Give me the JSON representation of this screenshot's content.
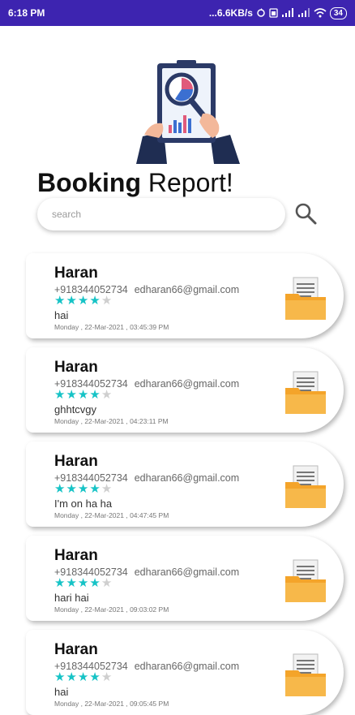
{
  "status_bar": {
    "time": "6:18 PM",
    "network_speed": "...6.6KB/s",
    "battery": "34",
    "icons": [
      "sync-icon",
      "sim-icon",
      "signal-icon",
      "signal-icon",
      "wifi-icon"
    ]
  },
  "header": {
    "title_bold": "Booking",
    "title_rest": " Report!",
    "illustration": "clipboard-magnifier-illustration"
  },
  "search": {
    "placeholder": "search",
    "value": "",
    "icon": "search-icon"
  },
  "colors": {
    "status_bar": "#3d24b0",
    "star_filled": "#16c3c6",
    "star_empty": "#cfcfcf",
    "folder": "#f4a42a"
  },
  "bookings": [
    {
      "name": "Haran",
      "phone": "+918344052734",
      "email": "edharan66@gmail.com",
      "rating": 4,
      "max_rating": 5,
      "message": "hai",
      "date": "Monday , 22-Mar-2021 , 03:45:39 PM"
    },
    {
      "name": "Haran",
      "phone": "+918344052734",
      "email": "edharan66@gmail.com",
      "rating": 4,
      "max_rating": 5,
      "message": "ghhtcvgy",
      "date": "Monday , 22-Mar-2021 , 04:23:11 PM"
    },
    {
      "name": "Haran",
      "phone": "+918344052734",
      "email": "edharan66@gmail.com",
      "rating": 4,
      "max_rating": 5,
      "message": "I'm on ha ha",
      "date": "Monday , 22-Mar-2021 , 04:47:45 PM"
    },
    {
      "name": "Haran",
      "phone": "+918344052734",
      "email": "edharan66@gmail.com",
      "rating": 4,
      "max_rating": 5,
      "message": "hari hai",
      "date": "Monday , 22-Mar-2021 , 09:03:02 PM"
    },
    {
      "name": "Haran",
      "phone": "+918344052734",
      "email": "edharan66@gmail.com",
      "rating": 4,
      "max_rating": 5,
      "message": "hai",
      "date": "Monday , 22-Mar-2021 , 09:05:45 PM"
    }
  ]
}
